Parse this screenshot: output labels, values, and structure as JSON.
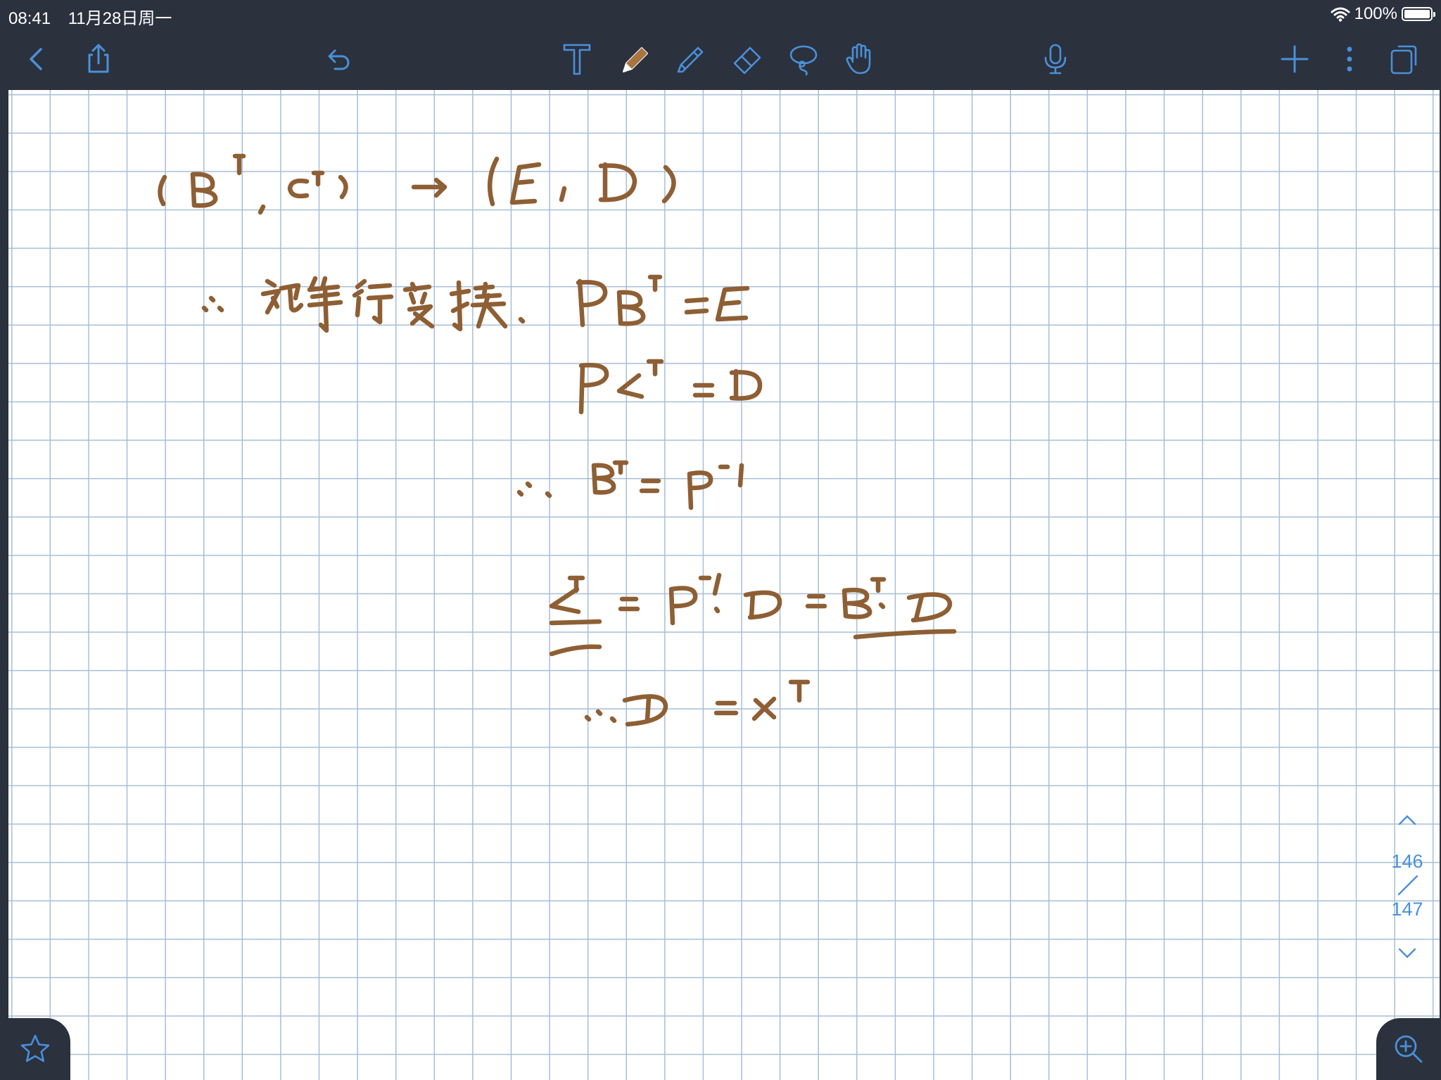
{
  "status_bar": {
    "time": "08:41",
    "date": "11月28日周一",
    "battery": "100%"
  },
  "toolbar": {
    "left": [
      "back-icon",
      "share-icon",
      "undo-icon"
    ],
    "tools": [
      "text-tool-icon",
      "pen-icon",
      "highlighter-icon",
      "eraser-icon",
      "lasso-icon",
      "hand-icon"
    ],
    "right": [
      "microphone-icon",
      "add-icon",
      "more-icon",
      "pages-icon"
    ]
  },
  "pager": {
    "current": "146",
    "total": "147"
  },
  "colors": {
    "chrome": "#2b313d",
    "accent": "#4a90d9",
    "ink": "#8e5f34",
    "grid": "#a6bed8"
  }
}
